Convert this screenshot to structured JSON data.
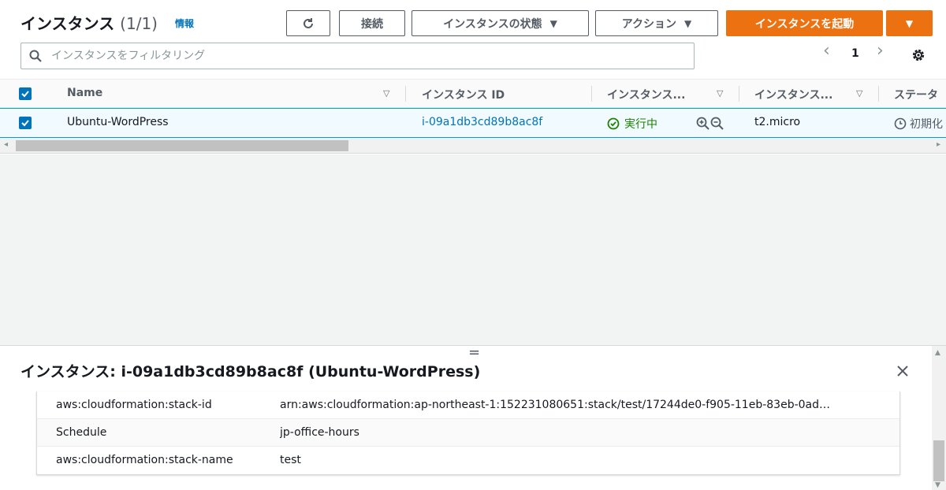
{
  "header": {
    "title": "インスタンス",
    "count": "(1/1)",
    "info_link": "情報",
    "refresh_icon": "refresh-icon",
    "connect_label": "接続",
    "instance_state_label": "インスタンスの状態",
    "actions_label": "アクション",
    "launch_label": "インスタンスを起動",
    "dropdown_caret": "▼"
  },
  "filter": {
    "placeholder": "インスタンスをフィルタリング"
  },
  "pagination": {
    "prev": "‹",
    "page": "1",
    "next": "›"
  },
  "table": {
    "columns": [
      "Name",
      "インスタンス ID",
      "インスタンス...",
      "インスタンス...",
      "ステータ"
    ],
    "rows": [
      {
        "name": "Ubuntu-WordPress",
        "instance_id": "i-09a1db3cd89b8ac8f",
        "state": "実行中",
        "type": "t2.micro",
        "status": "初期化"
      }
    ]
  },
  "detail": {
    "title": "インスタンス: i-09a1db3cd89b8ac8f (Ubuntu-WordPress)",
    "drag_handle": "=",
    "tags": [
      {
        "key": "aws:cloudformation:stack-id",
        "value": "arn:aws:cloudformation:ap-northeast-1:152231080651:stack/test/17244de0-f905-11eb-83eb-0ad…"
      },
      {
        "key": "Schedule",
        "value": "jp-office-hours"
      },
      {
        "key": "aws:cloudformation:stack-name",
        "value": "test"
      }
    ]
  },
  "colors": {
    "accent": "#ec7211",
    "link": "#0073bb",
    "running": "#1d8102",
    "selected_row": "#f1faff"
  }
}
